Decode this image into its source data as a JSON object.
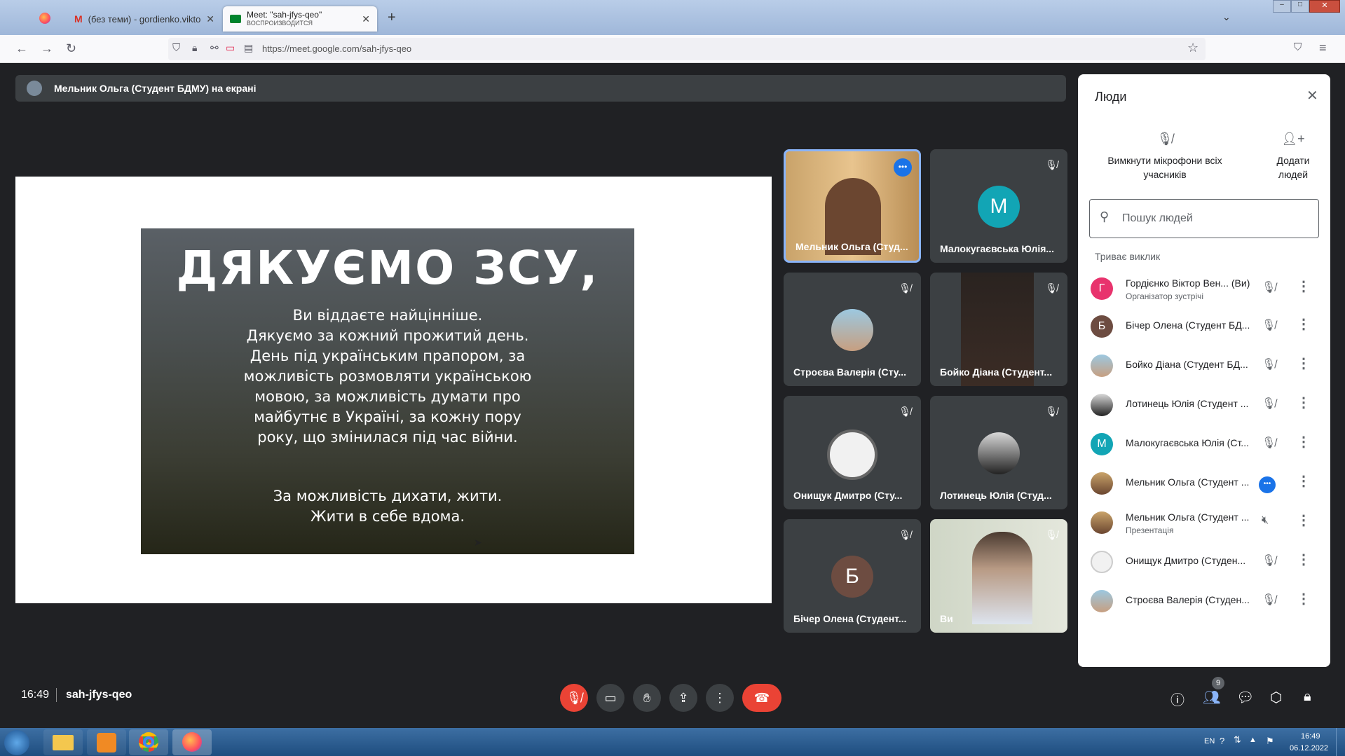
{
  "browser": {
    "tabs": [
      {
        "label": "(без теми) - gordienko.viktor@"
      },
      {
        "label": "Meet: \"sah-jfys-qeo\"",
        "sublabel": "ВОСПРОИЗВОДИТСЯ"
      }
    ],
    "new_tab": "+",
    "url": "https://meet.google.com/sah-jfys-qeo"
  },
  "presenting": {
    "label": "Мельник Ольга (Студент БДМУ) на екрані"
  },
  "slide": {
    "heading": "ДЯКУЄМО ЗСУ,",
    "lines": [
      "Ви віддаєте найцінніше.",
      "Дякуємо за кожний прожитий день.",
      "День під українським прапором, за",
      "можливість розмовляти українською",
      "мовою, за можливість думати про",
      "майбутнє в Україні, за кожну пору",
      "року, що змінилася під час війни."
    ],
    "closing": [
      "За можливість дихати, жити.",
      "Жити в себе вдома."
    ]
  },
  "tiles": [
    {
      "name": "Мельник Ольга (Студ..."
    },
    {
      "name": "Малокугаєвська Юлія...",
      "initial": "М"
    },
    {
      "name": "Строєва Валерія (Сту..."
    },
    {
      "name": "Бойко Діана (Студент..."
    },
    {
      "name": "Онищук Дмитро (Сту..."
    },
    {
      "name": "Лотинець Юлія (Студ..."
    },
    {
      "name": "Бічер Олена (Студент...",
      "initial": "Б"
    },
    {
      "name": "Ви"
    }
  ],
  "people_panel": {
    "title": "Люди",
    "mute_all": "Вимкнути мікрофони всіх учасників",
    "add_people": "Додати людей",
    "search_placeholder": "Пошук людей",
    "section": "Триває виклик",
    "participants": [
      {
        "name": "Гордієнко Віктор Вен...",
        "you": "(Ви)",
        "sub": "Організатор зустрічі",
        "initial": "Г",
        "color": "#e8336d"
      },
      {
        "name": "Бічер Олена (Студент БД...",
        "initial": "Б",
        "color": "#6d4c41"
      },
      {
        "name": "Бойко Діана (Студент БД..."
      },
      {
        "name": "Лотинець Юлія (Студент ..."
      },
      {
        "name": "Малокугаєвська Юлія (Ст...",
        "initial": "М",
        "color": "#12a5b5"
      },
      {
        "name": "Мельник Ольга (Студент ..."
      },
      {
        "name": "Мельник Ольга (Студент ...",
        "sub": "Презентація"
      },
      {
        "name": "Онищук Дмитро (Студен..."
      },
      {
        "name": "Строєва Валерія (Студен..."
      }
    ]
  },
  "bottom": {
    "time": "16:49",
    "meeting_code": "sah-jfys-qeo",
    "people_count": "9"
  },
  "taskbar": {
    "lang": "EN",
    "time": "16:49",
    "date": "06.12.2022"
  }
}
